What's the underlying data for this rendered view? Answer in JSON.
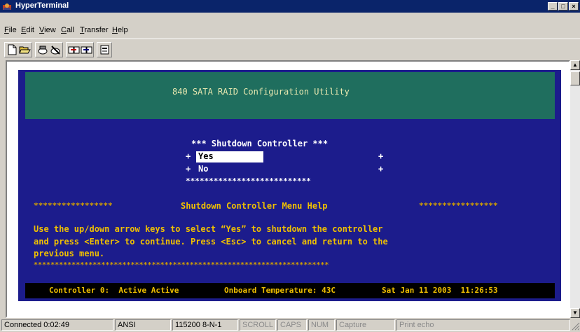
{
  "window": {
    "title": "HyperTerminal"
  },
  "menu": [
    {
      "label": "File",
      "accel": "F",
      "rest": "ile"
    },
    {
      "label": "Edit",
      "accel": "E",
      "rest": "dit"
    },
    {
      "label": "View",
      "accel": "V",
      "rest": "iew"
    },
    {
      "label": "Call",
      "accel": "C",
      "rest": "all"
    },
    {
      "label": "Transfer",
      "accel": "T",
      "rest": "ransfer"
    },
    {
      "label": "Help",
      "accel": "H",
      "rest": "elp"
    }
  ],
  "toolbar": {
    "icons": [
      "new-icon",
      "open-icon",
      "connect-icon",
      "disconnect-icon",
      "send-icon",
      "receive-icon",
      "properties-icon"
    ]
  },
  "terminal": {
    "header_title": "840 SATA RAID Configuration Utility",
    "menu_title": "*** Shutdown Controller ***",
    "options": [
      {
        "prefix": "+",
        "label": "Yes",
        "suffix": "+",
        "selected": true
      },
      {
        "prefix": "+",
        "label": "No",
        "suffix": "+",
        "selected": false
      }
    ],
    "menu_footer": "***************************",
    "help_header_left": "*****************",
    "help_header_title": "Shutdown Controller Menu Help",
    "help_header_right": "*****************",
    "help_lines": [
      "Use the up/down arrow keys to select “Yes” to shutdown the controller",
      "and press <Enter> to continue. Press <Esc> to cancel and return to the",
      "previous menu."
    ],
    "help_footer": "**********************************************************************",
    "status": {
      "controller": "Controller 0:  Active Active",
      "temperature": "Onboard Temperature: 43C",
      "datetime": "Sat Jan 11 2003  11:26:53"
    },
    "colors": {
      "background": "#1c1c8c",
      "header_band": "#1f6e5e",
      "text_yellow": "#f0c000"
    }
  },
  "statusbar": {
    "connected": "Connected 0:02:49",
    "emulation": "ANSI",
    "settings": "115200 8-N-1",
    "scroll": "SCROLL",
    "caps": "CAPS",
    "num": "NUM",
    "capture": "Capture",
    "print_echo": "Print echo"
  }
}
